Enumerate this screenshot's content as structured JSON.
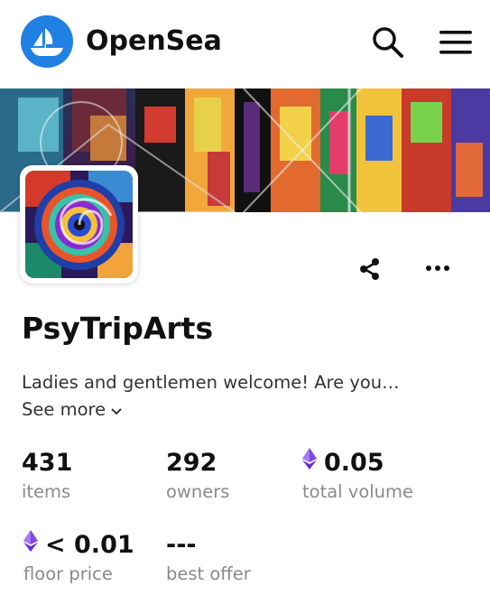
{
  "header": {
    "brand": "OpenSea",
    "logo_icon": "opensea-ship-icon",
    "search_icon": "search-icon",
    "menu_icon": "hamburger-menu-icon",
    "accent_color": "#2081e2"
  },
  "collection": {
    "name": "PsyTripArts",
    "description": "Ladies and gentlemen welcome! Are you…",
    "see_more": "See more",
    "share_icon": "share-icon",
    "more_icon": "more-options-icon"
  },
  "stats": [
    {
      "value": "431",
      "label": "items",
      "currency_icon": ""
    },
    {
      "value": "292",
      "label": "owners",
      "currency_icon": ""
    },
    {
      "value": "0.05",
      "label": "total volume",
      "currency_icon": "ethereum-icon"
    },
    {
      "value": "< 0.01",
      "label": "floor price",
      "currency_icon": "ethereum-icon"
    },
    {
      "value": "---",
      "label": "best offer",
      "currency_icon": ""
    }
  ]
}
